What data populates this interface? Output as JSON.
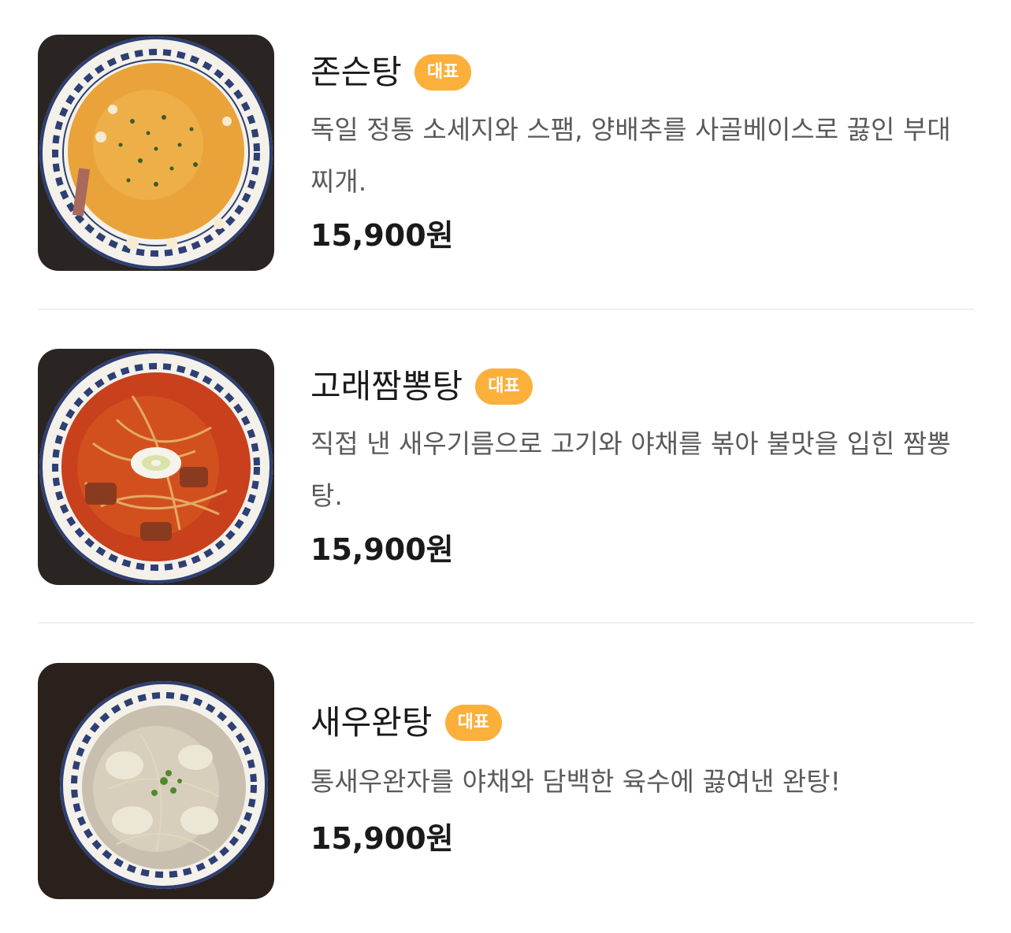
{
  "menu": {
    "items": [
      {
        "name": "존슨탕",
        "badge": "대표",
        "description": "독일 정통 소세지와 스팸, 양배추를 사골베이스로 끓인 부대찌개.",
        "price": "15,900원",
        "image_icon": "stew-bowl-image"
      },
      {
        "name": "고래짬뽕탕",
        "badge": "대표",
        "description": "직접 낸 새우기름으로 고기와 야채를 볶아 불맛을 입힌 짬뽕탕.",
        "price": "15,900원",
        "image_icon": "jjamppong-bowl-image"
      },
      {
        "name": "새우완탕",
        "badge": "대표",
        "description": "통새우완자를 야채와 담백한 육수에 끓여낸 완탕!",
        "price": "15,900원",
        "image_icon": "wonton-bowl-image"
      }
    ]
  },
  "colors": {
    "badge_bg": "#fbb03b",
    "badge_text": "#ffffff",
    "title_text": "#1a1a1a",
    "description_text": "#5a5a5a",
    "divider": "#efefef"
  }
}
